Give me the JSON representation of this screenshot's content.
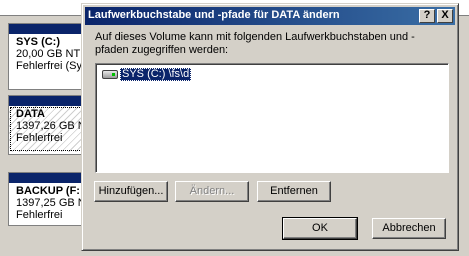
{
  "background": {
    "volumes": [
      {
        "name": "SYS  (C:)",
        "size": "20,00 GB NTF",
        "status": "Fehlerfrei (Sy"
      },
      {
        "name": "DATA",
        "size": "1397,26 GB N",
        "status": "Fehlerfrei"
      },
      {
        "name": "BACKUP  (F:",
        "size": "1397,25 GB N",
        "status": "Fehlerfrei"
      }
    ]
  },
  "dialog": {
    "title": "Laufwerkbuchstabe und -pfade für DATA ändern",
    "help_button": "?",
    "close_button": "X",
    "description": "Auf dieses Volume kann mit folgenden Laufwerkbuchstaben und -pfaden zugegriffen werden:",
    "list_items": [
      {
        "label": "SYS (C:) \\fs\\d",
        "icon": "drive-icon"
      }
    ],
    "buttons": {
      "add": "Hinzufügen...",
      "edit": "Ändern...",
      "remove": "Entfernen",
      "ok": "OK",
      "cancel": "Abbrechen"
    }
  },
  "colors": {
    "title_bar": "#0a246a",
    "selection": "#0a246a",
    "dialog_face": "#d4d0c8"
  }
}
